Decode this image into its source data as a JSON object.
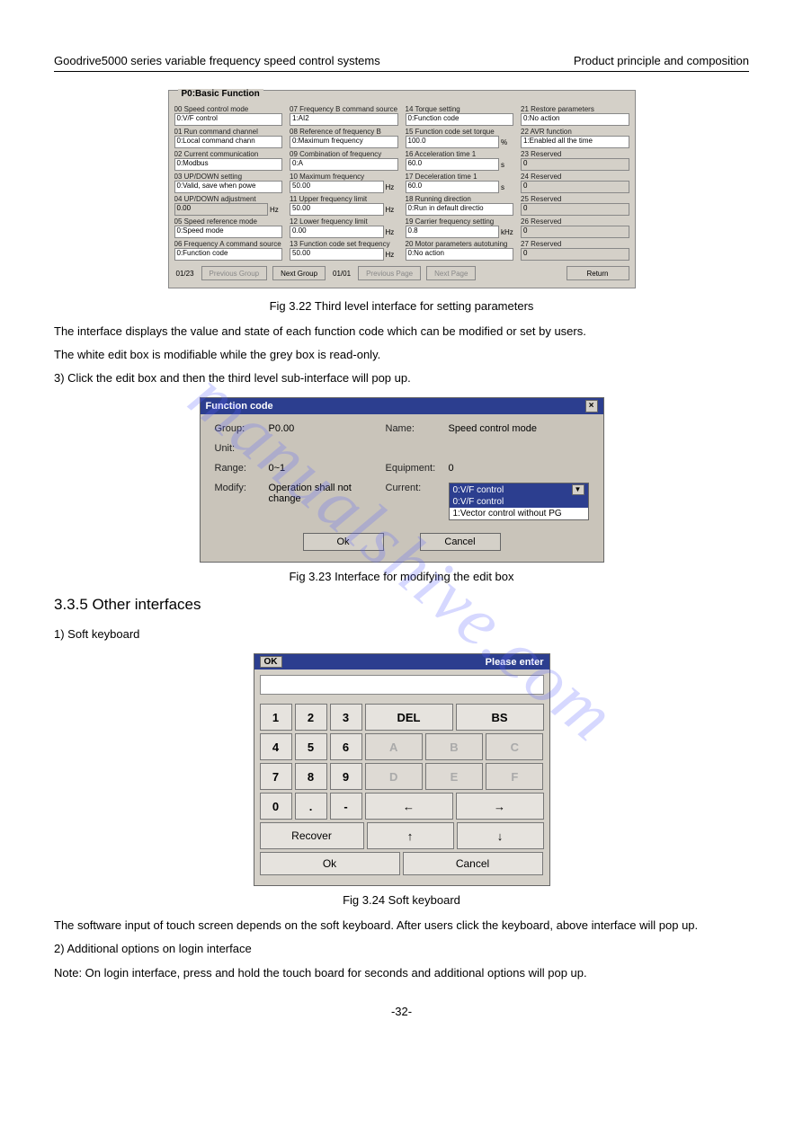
{
  "header": {
    "left": "Goodrive5000 series variable frequency speed control systems",
    "right": "Product principle and composition"
  },
  "watermark": "manualshive.com",
  "panel1": {
    "legend": "P0:Basic Function",
    "params": [
      {
        "label": "00 Speed control mode",
        "value": "0:V/F control",
        "unit": "",
        "ro": false
      },
      {
        "label": "07 Frequency B command source",
        "value": "1:AI2",
        "unit": "",
        "ro": false
      },
      {
        "label": "14 Torque setting",
        "value": "0:Function code",
        "unit": "",
        "ro": false
      },
      {
        "label": "21 Restore parameters",
        "value": "0:No action",
        "unit": "",
        "ro": false
      },
      {
        "label": "01 Run command channel",
        "value": "0:Local command chann",
        "unit": "",
        "ro": false
      },
      {
        "label": "08 Reference of frequency B",
        "value": "0:Maximum frequency",
        "unit": "",
        "ro": false
      },
      {
        "label": "15 Function code set torque",
        "value": "100.0",
        "unit": "%",
        "ro": false
      },
      {
        "label": "22 AVR function",
        "value": "1:Enabled all the time",
        "unit": "",
        "ro": false
      },
      {
        "label": "02 Current communication",
        "value": "0:Modbus",
        "unit": "",
        "ro": false
      },
      {
        "label": "09 Combination of frequency",
        "value": "0:A",
        "unit": "",
        "ro": false
      },
      {
        "label": "16 Acceleration time 1",
        "value": "60.0",
        "unit": "s",
        "ro": false
      },
      {
        "label": "23 Reserved",
        "value": "0",
        "unit": "",
        "ro": true
      },
      {
        "label": "03 UP/DOWN setting",
        "value": "0:Valid, save when powe",
        "unit": "",
        "ro": false
      },
      {
        "label": "10 Maximum frequency",
        "value": "50.00",
        "unit": "Hz",
        "ro": false
      },
      {
        "label": "17 Deceleration time 1",
        "value": "60.0",
        "unit": "s",
        "ro": false
      },
      {
        "label": "24 Reserved",
        "value": "0",
        "unit": "",
        "ro": true
      },
      {
        "label": "04 UP/DOWN adjustment",
        "value": "0.00",
        "unit": "Hz",
        "ro": true
      },
      {
        "label": "11 Upper frequency limit",
        "value": "50.00",
        "unit": "Hz",
        "ro": false
      },
      {
        "label": "18 Running direction",
        "value": "0:Run in default directio",
        "unit": "",
        "ro": false
      },
      {
        "label": "25 Reserved",
        "value": "0",
        "unit": "",
        "ro": true
      },
      {
        "label": "05 Speed reference mode",
        "value": "0:Speed mode",
        "unit": "",
        "ro": false
      },
      {
        "label": "12 Lower frequency limit",
        "value": "0.00",
        "unit": "Hz",
        "ro": false
      },
      {
        "label": "19 Carrier frequency setting",
        "value": "0.8",
        "unit": "kHz",
        "ro": false
      },
      {
        "label": "26 Reserved",
        "value": "0",
        "unit": "",
        "ro": true
      },
      {
        "label": "06 Frequency A command source",
        "value": "0:Function code",
        "unit": "",
        "ro": false
      },
      {
        "label": "13 Function code set frequency",
        "value": "50.00",
        "unit": "Hz",
        "ro": false
      },
      {
        "label": "20 Motor parameters autotuning",
        "value": "0:No action",
        "unit": "",
        "ro": false
      },
      {
        "label": "27 Reserved",
        "value": "0",
        "unit": "",
        "ro": true
      }
    ],
    "nav": {
      "count_group": "01/23",
      "prev_group": "Previous Group",
      "next_group": "Next Group",
      "count_page": "01/01",
      "prev_page": "Previous Page",
      "next_page": "Next Page",
      "return": "Return"
    }
  },
  "caption1": "Fig 3.22 Third level interface for setting parameters",
  "para1": "The interface displays the value and state of each function code which can be modified or set by users.",
  "para2": "The white edit box is modifiable while the grey box is read-only.",
  "para3": "3) Click the edit box and then the third level sub-interface will pop up.",
  "dialog": {
    "title": "Function code",
    "group_label": "Group:",
    "group_value": "P0.00",
    "name_label": "Name:",
    "name_value": "Speed control mode",
    "unit_label": "Unit:",
    "range_label": "Range:",
    "range_value": "0~1",
    "equipment_label": "Equipment:",
    "equipment_value": "0",
    "modify_label": "Modify:",
    "modify_value": "Operation shall not change",
    "current_label": "Current:",
    "dd_selected": "0:V/F control",
    "dd_options": [
      "0:V/F control",
      "1:Vector control without PG"
    ],
    "ok": "Ok",
    "cancel": "Cancel"
  },
  "caption2": "Fig 3.23 Interface for modifying the edit box",
  "section": "3.3.5 Other interfaces",
  "para4": "1) Soft keyboard",
  "keyboard": {
    "title_ok": "OK",
    "title_right": "Please enter",
    "rows": {
      "r1": [
        "1",
        "2",
        "3",
        "DEL",
        "BS"
      ],
      "r2": [
        "4",
        "5",
        "6",
        "A",
        "B",
        "C"
      ],
      "r3": [
        "7",
        "8",
        "9",
        "D",
        "E",
        "F"
      ],
      "r4": [
        "0",
        ".",
        "-",
        "←",
        "→"
      ],
      "r5": [
        "Recover",
        "↑",
        "↓"
      ],
      "r6": [
        "Ok",
        "Cancel"
      ]
    }
  },
  "caption3": "Fig 3.24 Soft keyboard",
  "para5": "The software input of touch screen depends on the soft keyboard. After users click the keyboard, above interface will pop up.",
  "para6": "2) Additional options on login interface",
  "para7": "Note: On login interface, press and hold the touch board for seconds and additional options will pop up.",
  "page_num": "-32-"
}
